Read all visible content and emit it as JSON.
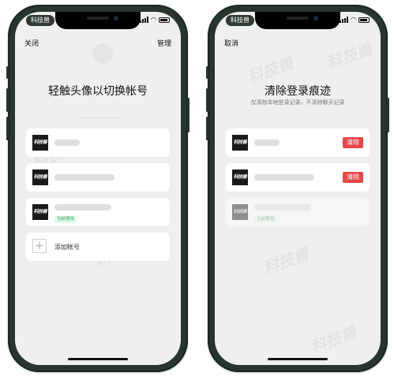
{
  "watermark": "科技兽",
  "left_screen": {
    "carrier": "科技兽",
    "close_label": "关闭",
    "manage_label": "管理",
    "title": "轻触头像以切换帐号",
    "accounts": [
      {
        "avatar_text": "科技兽",
        "current": false
      },
      {
        "avatar_text": "科技兽",
        "current": false
      },
      {
        "avatar_text": "科技兽",
        "current": true,
        "badge": "当前使用"
      }
    ],
    "add_account_label": "添加帐号"
  },
  "right_screen": {
    "carrier": "科技兽",
    "cancel_label": "取消",
    "title": "清除登录痕迹",
    "subtitle": "仅清除本地登录记录，不清除聊天记录",
    "accounts": [
      {
        "avatar_text": "科技兽",
        "clear_label": "清除"
      },
      {
        "avatar_text": "科技兽",
        "clear_label": "清除"
      },
      {
        "avatar_text": "科技兽",
        "badge": "当前使用"
      }
    ]
  },
  "colors": {
    "phone_frame": "#27352c",
    "screen_bg": "#efefef",
    "clear_button": "#e4474a",
    "badge_text": "#2eaa5c",
    "badge_bg": "#e6f7ec"
  }
}
